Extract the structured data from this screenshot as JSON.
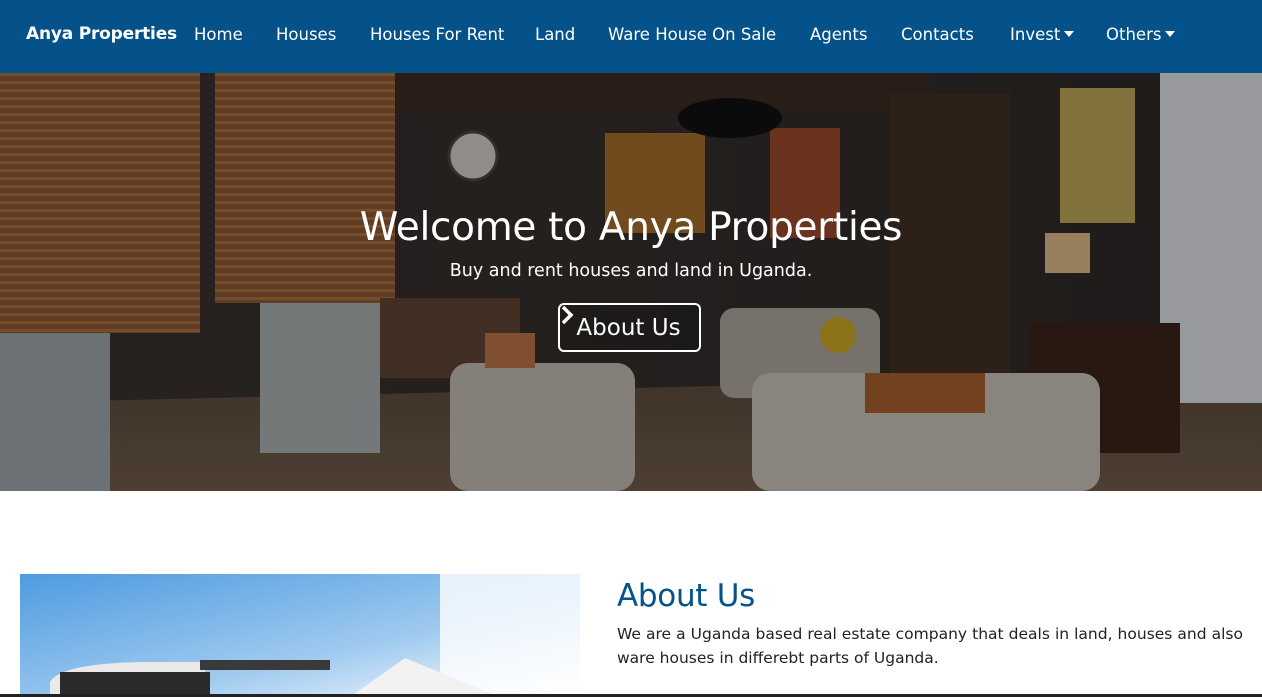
{
  "navbar": {
    "brand": "Anya Properties",
    "items": [
      {
        "label": "Home"
      },
      {
        "label": "Houses"
      },
      {
        "label": "Houses For Rent"
      },
      {
        "label": "Land"
      },
      {
        "label": "Ware House On Sale"
      },
      {
        "label": "Agents"
      },
      {
        "label": "Contacts"
      },
      {
        "label": "Invest",
        "dropdown": true
      },
      {
        "label": "Others",
        "dropdown": true
      }
    ],
    "bg_color": "#05528a"
  },
  "hero": {
    "title": "Welcome to Anya Properties",
    "subtitle": "Buy and rent houses and land in Uganda.",
    "button_label": "About Us",
    "button_icon": "chevron-right-icon"
  },
  "about": {
    "title": "About Us",
    "text": "We are a Uganda based real estate company that deals in land, houses and also ware houses in differebt parts of Uganda.",
    "title_color": "#05528a"
  }
}
